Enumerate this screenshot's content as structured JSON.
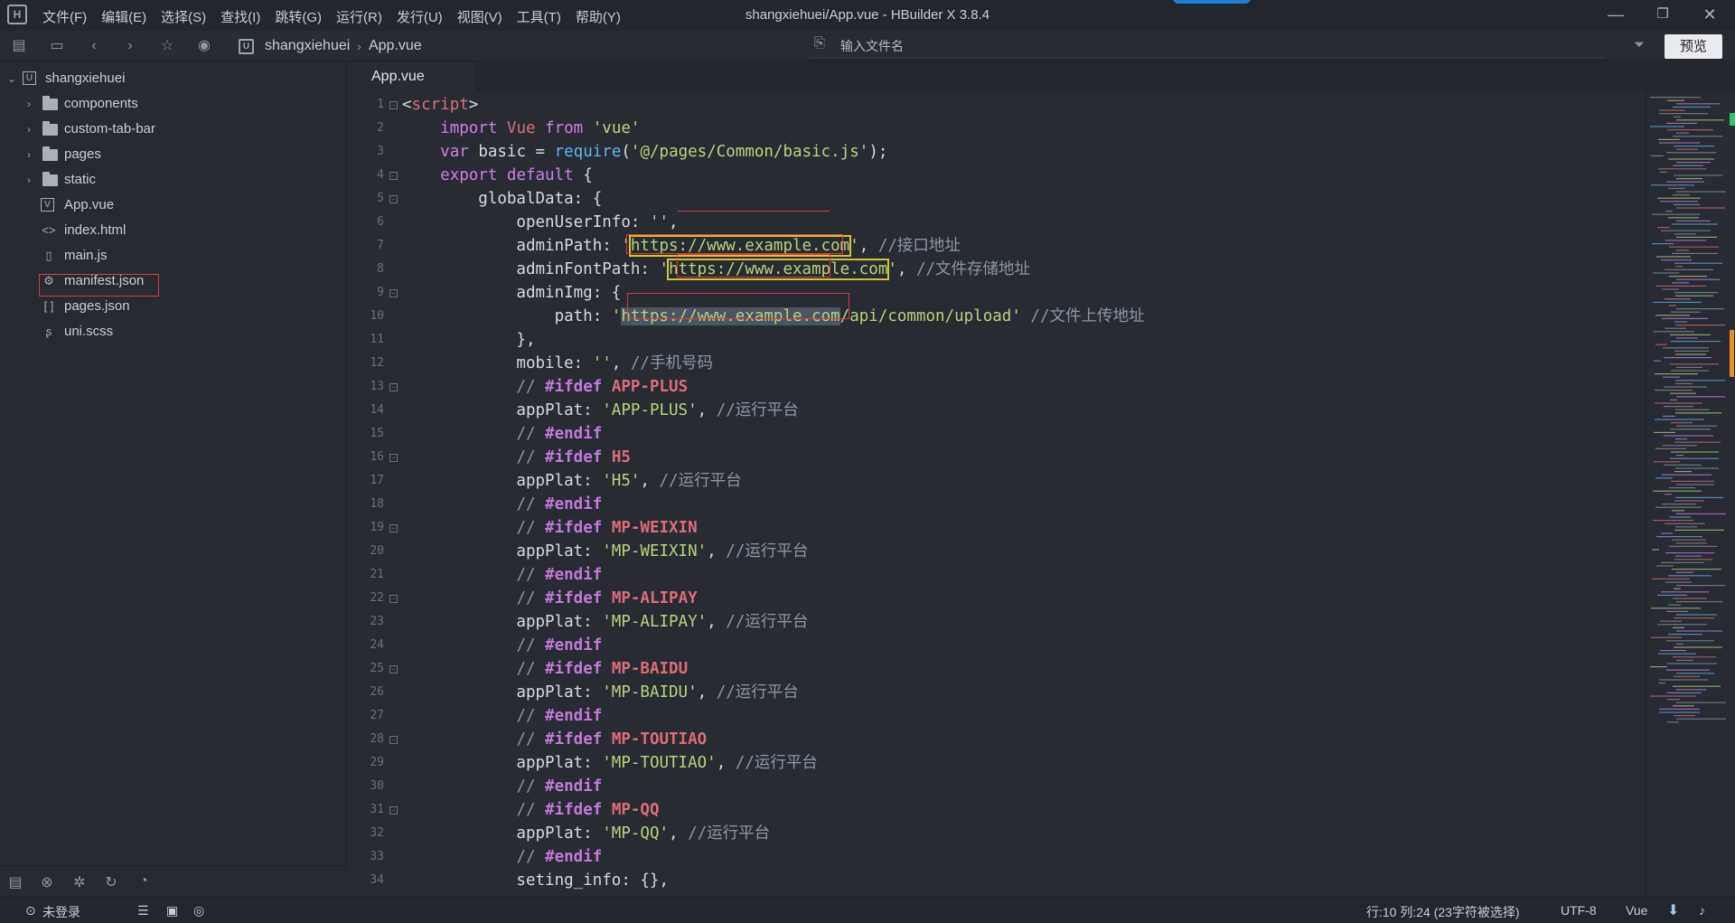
{
  "window": {
    "title": "shangxiehuei/App.vue - HBuilder X 3.8.4",
    "logo": "H"
  },
  "menu": [
    "文件(F)",
    "编辑(E)",
    "选择(S)",
    "查找(I)",
    "跳转(G)",
    "运行(R)",
    "发行(U)",
    "视图(V)",
    "工具(T)",
    "帮助(Y)"
  ],
  "toolbar": {
    "breadcrumb_project": "shangxiehuei",
    "breadcrumb_file": "App.vue",
    "search_placeholder": "输入文件名",
    "preview_label": "预览"
  },
  "tree": [
    {
      "label": "shangxiehuei",
      "type": "project",
      "depth": 0,
      "expanded": true
    },
    {
      "label": "components",
      "type": "folder",
      "depth": 1
    },
    {
      "label": "custom-tab-bar",
      "type": "folder",
      "depth": 1
    },
    {
      "label": "pages",
      "type": "folder",
      "depth": 1
    },
    {
      "label": "static",
      "type": "folder",
      "depth": 1
    },
    {
      "label": "App.vue",
      "type": "vue",
      "depth": 1,
      "selected": true
    },
    {
      "label": "index.html",
      "type": "html",
      "depth": 1
    },
    {
      "label": "main.js",
      "type": "file",
      "depth": 1
    },
    {
      "label": "manifest.json",
      "type": "manifest",
      "depth": 1
    },
    {
      "label": "pages.json",
      "type": "json",
      "depth": 1
    },
    {
      "label": "uni.scss",
      "type": "scss",
      "depth": 1
    }
  ],
  "editor": {
    "tab": "App.vue",
    "lines": [
      {
        "n": 1,
        "fold": true,
        "segs": [
          [
            "pl",
            "<"
          ],
          [
            "kw2",
            "script"
          ],
          [
            "pl",
            ">"
          ]
        ]
      },
      {
        "n": 2,
        "segs": [
          [
            "pl",
            "    "
          ],
          [
            "kw",
            "import "
          ],
          [
            "kw2",
            "Vue "
          ],
          [
            "kw",
            "from "
          ],
          [
            "st",
            "'vue'"
          ]
        ]
      },
      {
        "n": 3,
        "segs": [
          [
            "pl",
            "    "
          ],
          [
            "kw",
            "var "
          ],
          [
            "pl",
            "basic = "
          ],
          [
            "fn",
            "require"
          ],
          [
            "pl",
            "("
          ],
          [
            "st",
            "'@/pages/Common/basic.js'"
          ],
          [
            "pl",
            ");"
          ]
        ]
      },
      {
        "n": 4,
        "fold": true,
        "segs": [
          [
            "pl",
            "    "
          ],
          [
            "kw",
            "export default "
          ],
          [
            "pl",
            "{"
          ]
        ]
      },
      {
        "n": 5,
        "fold": true,
        "segs": [
          [
            "pl",
            "        globalData: {"
          ]
        ]
      },
      {
        "n": 6,
        "segs": [
          [
            "pl",
            "            openUserInfo: "
          ],
          [
            "st",
            "''"
          ],
          [
            "pl",
            ","
          ]
        ]
      },
      {
        "n": 7,
        "segs": [
          [
            "pl",
            "            adminPath: "
          ],
          [
            "st",
            "'"
          ],
          [
            "st_y",
            "https://www.example.com"
          ],
          [
            "st",
            "'"
          ],
          [
            "pl",
            ", "
          ],
          [
            "cm",
            "//接口地址"
          ]
        ]
      },
      {
        "n": 8,
        "segs": [
          [
            "pl",
            "            adminFontPath: "
          ],
          [
            "st",
            "'"
          ],
          [
            "st_y",
            "https://www.example.com"
          ],
          [
            "st",
            "'"
          ],
          [
            "pl",
            ", "
          ],
          [
            "cm",
            "//文件存储地址"
          ]
        ]
      },
      {
        "n": 9,
        "fold": true,
        "segs": [
          [
            "pl",
            "            adminImg: {"
          ]
        ]
      },
      {
        "n": 10,
        "segs": [
          [
            "pl",
            "                path: "
          ],
          [
            "st",
            "'"
          ],
          [
            "st_sel",
            "https://www.example.com"
          ],
          [
            "st",
            "/api/common/upload'"
          ],
          [
            "pl",
            " "
          ],
          [
            "cm",
            "//文件上传地址"
          ]
        ]
      },
      {
        "n": 11,
        "segs": [
          [
            "pl",
            "            },"
          ]
        ]
      },
      {
        "n": 12,
        "segs": [
          [
            "pl",
            "            mobile: "
          ],
          [
            "st",
            "''"
          ],
          [
            "pl",
            ", "
          ],
          [
            "cm",
            "//手机号码"
          ]
        ]
      },
      {
        "n": 13,
        "fold": true,
        "segs": [
          [
            "pl",
            "            "
          ],
          [
            "cm",
            "// "
          ],
          [
            "ppk",
            "#ifdef "
          ],
          [
            "pp",
            "APP-PLUS"
          ]
        ]
      },
      {
        "n": 14,
        "segs": [
          [
            "pl",
            "            appPlat: "
          ],
          [
            "st",
            "'APP-PLUS'"
          ],
          [
            "pl",
            ", "
          ],
          [
            "cm",
            "//运行平台"
          ]
        ]
      },
      {
        "n": 15,
        "segs": [
          [
            "pl",
            "            "
          ],
          [
            "cm",
            "// "
          ],
          [
            "ppk",
            "#endif"
          ]
        ]
      },
      {
        "n": 16,
        "fold": true,
        "segs": [
          [
            "pl",
            "            "
          ],
          [
            "cm",
            "// "
          ],
          [
            "ppk",
            "#ifdef "
          ],
          [
            "pp",
            "H5"
          ]
        ]
      },
      {
        "n": 17,
        "segs": [
          [
            "pl",
            "            appPlat: "
          ],
          [
            "st",
            "'H5'"
          ],
          [
            "pl",
            ", "
          ],
          [
            "cm",
            "//运行平台"
          ]
        ]
      },
      {
        "n": 18,
        "segs": [
          [
            "pl",
            "            "
          ],
          [
            "cm",
            "// "
          ],
          [
            "ppk",
            "#endif"
          ]
        ]
      },
      {
        "n": 19,
        "fold": true,
        "segs": [
          [
            "pl",
            "            "
          ],
          [
            "cm",
            "// "
          ],
          [
            "ppk",
            "#ifdef "
          ],
          [
            "pp",
            "MP-WEIXIN"
          ]
        ]
      },
      {
        "n": 20,
        "segs": [
          [
            "pl",
            "            appPlat: "
          ],
          [
            "st",
            "'MP-WEIXIN'"
          ],
          [
            "pl",
            ", "
          ],
          [
            "cm",
            "//运行平台"
          ]
        ]
      },
      {
        "n": 21,
        "segs": [
          [
            "pl",
            "            "
          ],
          [
            "cm",
            "// "
          ],
          [
            "ppk",
            "#endif"
          ]
        ]
      },
      {
        "n": 22,
        "fold": true,
        "segs": [
          [
            "pl",
            "            "
          ],
          [
            "cm",
            "// "
          ],
          [
            "ppk",
            "#ifdef "
          ],
          [
            "pp",
            "MP-ALIPAY"
          ]
        ]
      },
      {
        "n": 23,
        "segs": [
          [
            "pl",
            "            appPlat: "
          ],
          [
            "st",
            "'MP-ALIPAY'"
          ],
          [
            "pl",
            ", "
          ],
          [
            "cm",
            "//运行平台"
          ]
        ]
      },
      {
        "n": 24,
        "segs": [
          [
            "pl",
            "            "
          ],
          [
            "cm",
            "// "
          ],
          [
            "ppk",
            "#endif"
          ]
        ]
      },
      {
        "n": 25,
        "fold": true,
        "segs": [
          [
            "pl",
            "            "
          ],
          [
            "cm",
            "// "
          ],
          [
            "ppk",
            "#ifdef "
          ],
          [
            "pp",
            "MP-BAIDU"
          ]
        ]
      },
      {
        "n": 26,
        "segs": [
          [
            "pl",
            "            appPlat: "
          ],
          [
            "st",
            "'MP-BAIDU'"
          ],
          [
            "pl",
            ", "
          ],
          [
            "cm",
            "//运行平台"
          ]
        ]
      },
      {
        "n": 27,
        "segs": [
          [
            "pl",
            "            "
          ],
          [
            "cm",
            "// "
          ],
          [
            "ppk",
            "#endif"
          ]
        ]
      },
      {
        "n": 28,
        "fold": true,
        "segs": [
          [
            "pl",
            "            "
          ],
          [
            "cm",
            "// "
          ],
          [
            "ppk",
            "#ifdef "
          ],
          [
            "pp",
            "MP-TOUTIAO"
          ]
        ]
      },
      {
        "n": 29,
        "segs": [
          [
            "pl",
            "            appPlat: "
          ],
          [
            "st",
            "'MP-TOUTIAO'"
          ],
          [
            "pl",
            ", "
          ],
          [
            "cm",
            "//运行平台"
          ]
        ]
      },
      {
        "n": 30,
        "segs": [
          [
            "pl",
            "            "
          ],
          [
            "cm",
            "// "
          ],
          [
            "ppk",
            "#endif"
          ]
        ]
      },
      {
        "n": 31,
        "fold": true,
        "segs": [
          [
            "pl",
            "            "
          ],
          [
            "cm",
            "// "
          ],
          [
            "ppk",
            "#ifdef "
          ],
          [
            "pp",
            "MP-QQ"
          ]
        ]
      },
      {
        "n": 32,
        "segs": [
          [
            "pl",
            "            appPlat: "
          ],
          [
            "st",
            "'MP-QQ'"
          ],
          [
            "pl",
            ", "
          ],
          [
            "cm",
            "//运行平台"
          ]
        ]
      },
      {
        "n": 33,
        "segs": [
          [
            "pl",
            "            "
          ],
          [
            "cm",
            "// "
          ],
          [
            "ppk",
            "#endif"
          ]
        ]
      },
      {
        "n": 34,
        "segs": [
          [
            "pl",
            "            seting_info: {},"
          ]
        ]
      }
    ]
  },
  "status": {
    "login": "未登录",
    "position": "行:10  列:24 (23字符被选择)",
    "encoding": "UTF-8",
    "language": "Vue"
  },
  "colors": {
    "background": "#272b33",
    "keyword": "#d27ee6",
    "string": "#b8d47a",
    "comment": "#8e96a3",
    "highlight_box": "#d9c230",
    "annotation_box": "#e03a3a"
  }
}
